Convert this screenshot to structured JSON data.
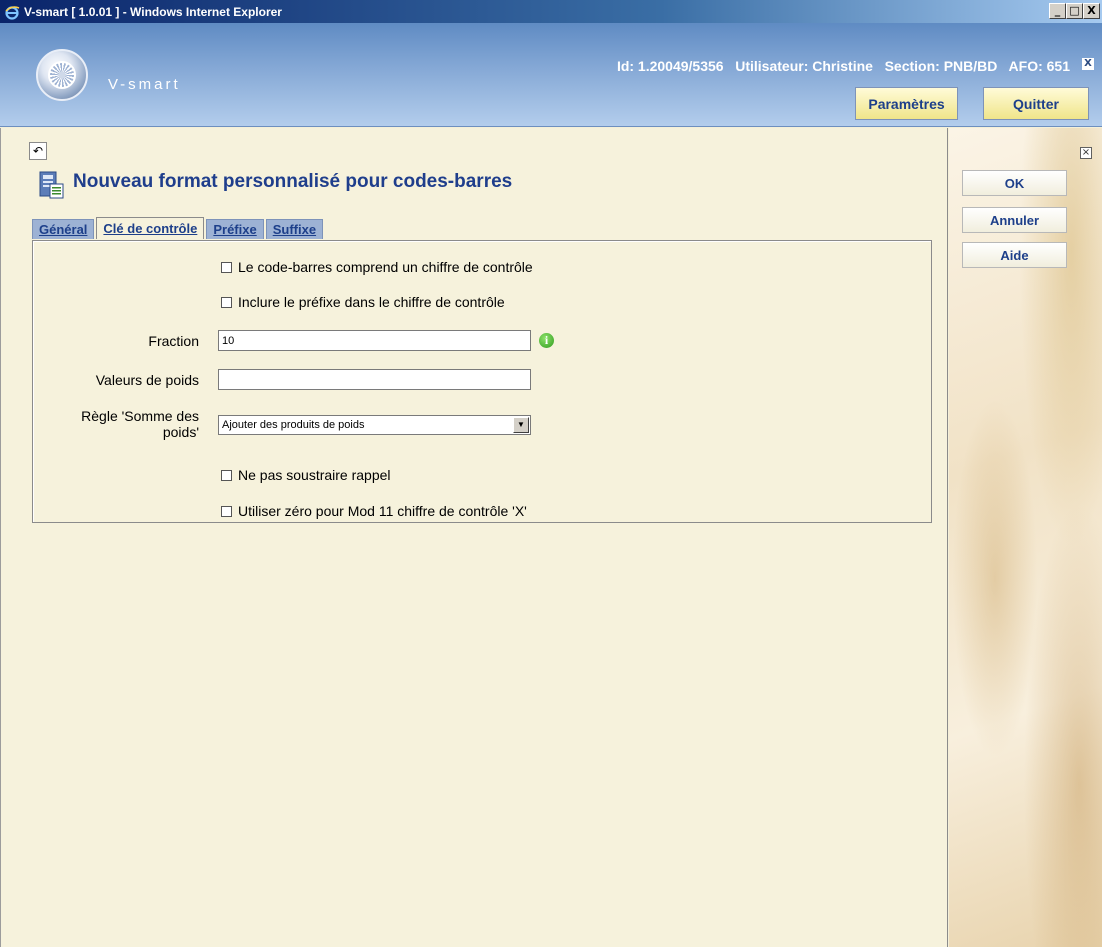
{
  "window": {
    "title": "V-smart [ 1.0.01 ] - Windows Internet Explorer",
    "controls": [
      "_",
      "□",
      "X"
    ]
  },
  "header": {
    "app_name": "V-smart",
    "session_info": "Id: 1.20049/5356   Utilisateur: Christine   Section: PNB/BD   AFO: 651",
    "close_symbol": "X",
    "buttons": {
      "params": "Paramètres",
      "quit": "Quitter"
    }
  },
  "main": {
    "back_symbol": "↶",
    "title": "Nouveau format personnalisé pour codes-barres",
    "tabs": [
      {
        "label": "Général",
        "active": false
      },
      {
        "label": "Clé de contrôle",
        "active": true
      },
      {
        "label": "Préfixe",
        "active": false
      },
      {
        "label": "Suffixe",
        "active": false
      }
    ],
    "form": {
      "check_digit_included": {
        "label": "Le code-barres comprend un chiffre de contrôle",
        "checked": false
      },
      "include_prefix": {
        "label": "Inclure le préfixe dans le chiffre de contrôle",
        "checked": false
      },
      "fraction": {
        "label": "Fraction",
        "value": "10",
        "info_symbol": "i"
      },
      "weights": {
        "label": "Valeurs de poids",
        "value": ""
      },
      "sum_rule": {
        "label": "Règle 'Somme des poids'",
        "selected": "Ajouter des produits de poids",
        "arrow": "▼"
      },
      "no_subtract": {
        "label": "Ne pas soustraire rappel",
        "checked": false
      },
      "mod11_zero": {
        "label": "Utiliser zéro pour Mod 11 chiffre de contrôle 'X'",
        "checked": false
      }
    }
  },
  "sidebar": {
    "close_symbol": "×",
    "buttons": {
      "ok": "OK",
      "cancel": "Annuler",
      "help": "Aide"
    }
  }
}
